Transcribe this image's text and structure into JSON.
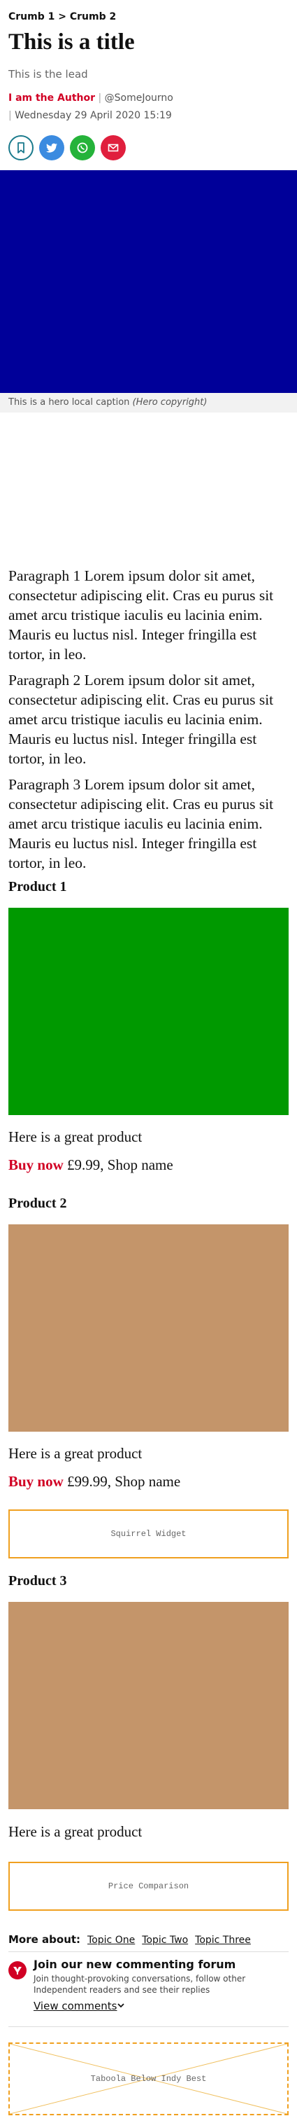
{
  "breadcrumb": {
    "crumb1": "Crumb 1",
    "separator": ">",
    "crumb2": "Crumb 2"
  },
  "article": {
    "title": "This is a title",
    "lead": "This is the lead",
    "author_name": "I am the Author",
    "author_handle": "@SomeJourno",
    "date": "Wednesday 29 April 2020 15:19"
  },
  "share": {
    "buttons": [
      {
        "icon": "bookmark-icon",
        "color": "#ffffff",
        "border": "#1a7a8c"
      },
      {
        "icon": "twitter-icon",
        "color": "#3b8be0"
      },
      {
        "icon": "whatsapp-icon",
        "color": "#25b33a"
      },
      {
        "icon": "email-icon",
        "color": "#e01f3d"
      }
    ]
  },
  "hero": {
    "color": "#000099",
    "caption": "This is a hero local caption",
    "copyright": "(Hero copyright)"
  },
  "paragraphs": [
    "Paragraph 1 Lorem ipsum dolor sit amet, consectetur adipiscing elit. Cras eu purus sit amet arcu tristique iaculis eu lacinia enim. Mauris eu luctus nisl. Integer fringilla est tortor, in leo.",
    "Paragraph 2 Lorem ipsum dolor sit amet, consectetur adipiscing elit. Cras eu purus sit amet arcu tristique iaculis eu lacinia enim. Mauris eu luctus nisl. Integer fringilla est tortor, in leo.",
    "Paragraph 3 Lorem ipsum dolor sit amet, consectetur adipiscing elit. Cras eu purus sit amet arcu tristique iaculis eu lacinia enim. Mauris eu luctus nisl. Integer fringilla est tortor, in leo."
  ],
  "products": [
    {
      "title": "Product 1",
      "image_color": "#009900",
      "desc": "Here is a great product",
      "buy": "Buy now",
      "price": "£9.99, Shop name"
    },
    {
      "title": "Product 2",
      "image_color": "#c4956a",
      "desc": "Here is a great product",
      "buy": "Buy now",
      "price": "£99.99, Shop name"
    },
    {
      "title": "Product 3",
      "image_color": "#c4956a",
      "desc": "Here is a great product"
    }
  ],
  "widgets": {
    "squirrel": "Squirrel Widget",
    "price_comparison": "Price Comparison",
    "taboola": "Taboola Below Indy Best"
  },
  "more_about": {
    "label": "More about:",
    "topics": [
      "Topic One",
      "Topic Two",
      "Topic Three"
    ]
  },
  "comments": {
    "title": "Join our new commenting forum",
    "desc": "Join thought-provoking conversations, follow other Independent readers and see their replies",
    "view": "View comments"
  },
  "colors": {
    "accent": "#d10024",
    "widget_border": "#f0a020"
  }
}
